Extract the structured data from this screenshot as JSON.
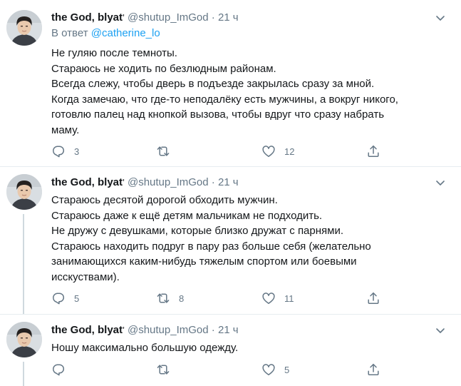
{
  "tweets": [
    {
      "name": "the God, blyat",
      "handle": "@shutup_ImGod",
      "time": "21 ч",
      "reply_prefix": "В ответ",
      "reply_handle": "@catherine_lo",
      "lines": [
        "Не гуляю после темноты.",
        "Стараюсь не ходить по безлюдным районам.",
        "Всегда слежу, чтобы дверь в подъезде закрылась сразу за мной.",
        "Когда замечаю, что где-то неподалёку есть мужчины, а вокруг никого,",
        "готовлю палец над кнопкой вызова, чтобы вдруг что сразу набрать",
        "маму."
      ],
      "replies": "3",
      "retweets": "",
      "likes": "12"
    },
    {
      "name": "the God, blyat",
      "handle": "@shutup_ImGod",
      "time": "21 ч",
      "lines": [
        "Стараюсь десятой дорогой обходить мужчин.",
        "Стараюсь даже к ещё детям мальчикам не подходить.",
        "Не дружу с девушками, которые близко дружат с парнями.",
        "Стараюсь находить подруг в пару раз больше себя (желательно",
        "занимающихся каким-нибудь тяжелым спортом или боевыми",
        "исскуствами)."
      ],
      "replies": "5",
      "retweets": "8",
      "likes": "11"
    },
    {
      "name": "the God, blyat",
      "handle": "@shutup_ImGod",
      "time": "21 ч",
      "lines": [
        "Ношу максимально большую одежду."
      ],
      "replies": "",
      "retweets": "",
      "likes": "5"
    }
  ],
  "separator": "·",
  "icons": [
    "avatar",
    "chevron-down-icon",
    "reply-icon",
    "retweet-icon",
    "like-icon",
    "share-icon"
  ],
  "colors": {
    "secondary": "#657786",
    "link": "#1da1f2",
    "divider": "#e6ecf0",
    "thread": "#cfd9de"
  }
}
